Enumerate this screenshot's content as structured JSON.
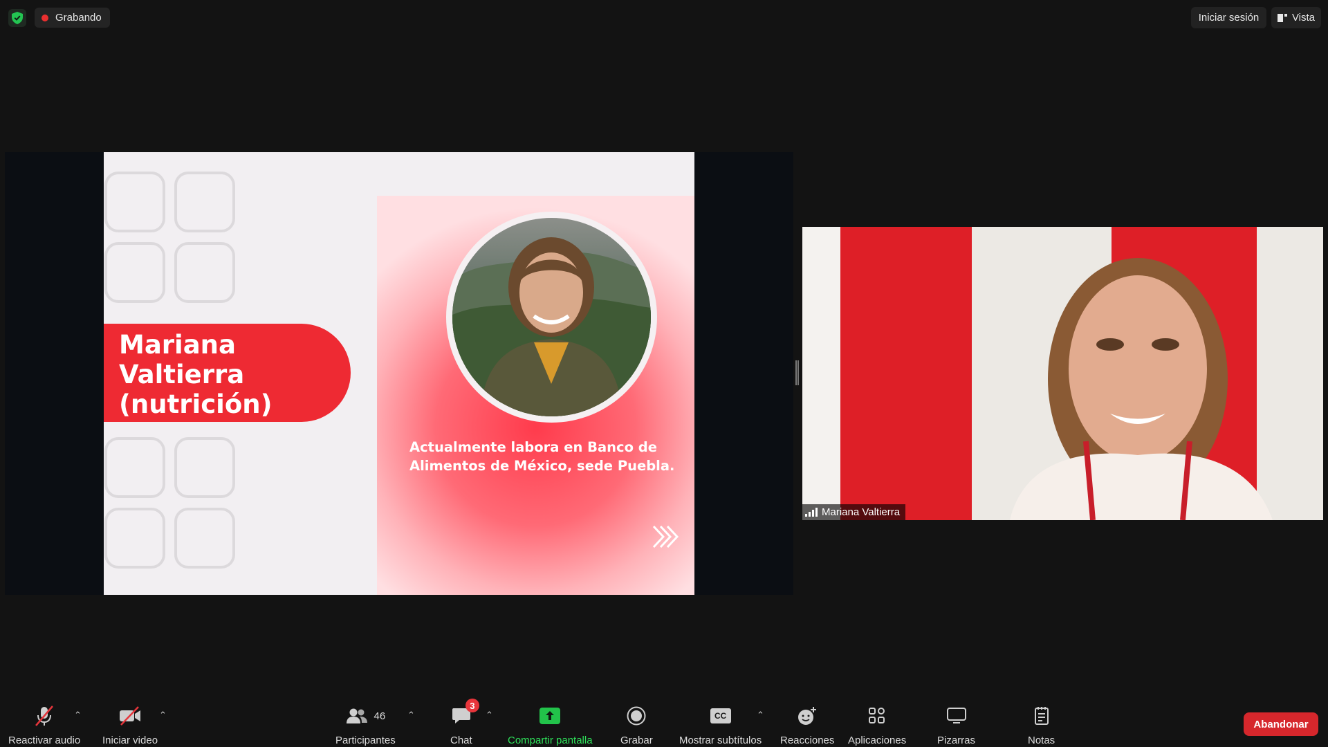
{
  "top_bar": {
    "security_icon": "shield-check-icon",
    "recording_label": "Grabando",
    "sign_in_label": "Iniciar sesión",
    "view_label": "Vista"
  },
  "shared_screen": {
    "slide": {
      "name": "Mariana\nValtierra\n(nutrición)",
      "bio": "Actualmente labora en Banco de\nAlimentos de México, sede Puebla.",
      "accent_color": "#ee2a33"
    }
  },
  "video": {
    "participant_name": "Mariana Valtierra"
  },
  "toolbar": {
    "unmute_label": "Reactivar audio",
    "start_video_label": "Iniciar video",
    "participants_label": "Participantes",
    "participants_count": "46",
    "chat_label": "Chat",
    "chat_badge": "3",
    "share_label": "Compartir pantalla",
    "share_color": "#22c34a",
    "record_label": "Grabar",
    "captions_label": "Mostrar subtítulos",
    "captions_icon_text": "CC",
    "reactions_label": "Reacciones",
    "apps_label": "Aplicaciones",
    "whiteboards_label": "Pizarras",
    "notes_label": "Notas",
    "leave_label": "Abandonar",
    "leave_color": "#d6272c"
  }
}
